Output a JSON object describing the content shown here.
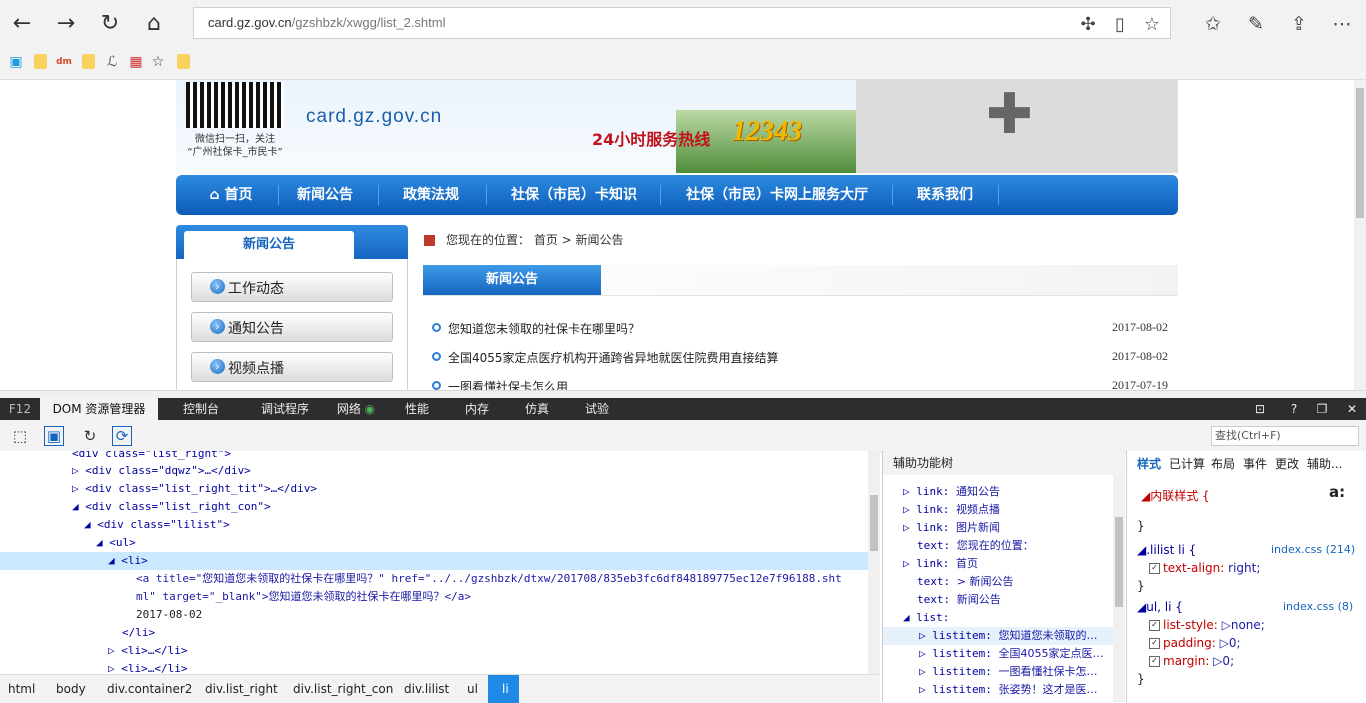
{
  "browser": {
    "url_host": "card.gz.gov.cn",
    "url_path": "/gzshbzk/xwgg/list_2.shtml"
  },
  "banner": {
    "qr_caption1": "微信扫一扫，关注",
    "qr_caption2": "“广州社保卡_市民卡”",
    "site_url": "card.gz.gov.cn",
    "hotline_label": "24小时服务热线",
    "hotline_number": "12343"
  },
  "nav": {
    "items": [
      "首页",
      "新闻公告",
      "政策法规",
      "社保（市民）卡知识",
      "社保（市民）卡网上服务大厅",
      "联系我们"
    ]
  },
  "sidebar": {
    "heading": "新闻公告",
    "items": [
      "工作动态",
      "通知公告",
      "视频点播"
    ]
  },
  "content": {
    "breadcrumb": "您现在的位置： 首页 > 新闻公告",
    "list_tab": "新闻公告",
    "news": [
      {
        "title": "您知道您未领取的社保卡在哪里吗？",
        "date": "2017-08-02"
      },
      {
        "title": "全国4055家定点医疗机构开通跨省异地就医住院费用直接结算",
        "date": "2017-08-02"
      },
      {
        "title": "一图看懂社保卡怎么用",
        "date": "2017-07-19"
      }
    ]
  },
  "devtools": {
    "tabs": [
      "F12",
      "DOM 资源管理器",
      "控制台",
      "调试程序",
      "网络",
      "性能",
      "内存",
      "仿真",
      "试验"
    ],
    "find_placeholder": "查找(Ctrl+F)",
    "dom_lines": [
      {
        "text": "<div class=\"list_right\">"
      },
      {
        "text": "▷ <div class=\"dqwz\">…</div>"
      },
      {
        "text": "▷ <div class=\"list_right_tit\">…</div>"
      },
      {
        "text": "◢ <div class=\"list_right_con\">"
      },
      {
        "text": "◢ <div class=\"lilist\">"
      },
      {
        "text": "◢ <ul>"
      },
      {
        "text": "◢ <li>"
      },
      {
        "text": "<a title=\"您知道您未领取的社保卡在哪里吗？\" href=\"../../gzshbzk/dtxw/201708/835eb3fc6df848189775ec12e7f96188.sht"
      },
      {
        "text": "ml\" target=\"_blank\">您知道您未领取的社保卡在哪里吗？</a>"
      },
      {
        "text": "2017-08-02"
      },
      {
        "text": "</li>"
      },
      {
        "text": "▷ <li>…</li>"
      },
      {
        "text": "▷ <li>…</li>"
      }
    ],
    "breadcrumbs": [
      "html",
      "body",
      "div.container2",
      "div.list_right",
      "div.list_right_con",
      "div.lilist",
      "ul",
      "li"
    ],
    "accessibility": {
      "title": "辅助功能树",
      "lines": [
        {
          "k": "▷ link:",
          "v": "通知公告"
        },
        {
          "k": "▷ link:",
          "v": "视频点播"
        },
        {
          "k": "▷ link:",
          "v": "图片新闻"
        },
        {
          "k": "text:",
          "v": "您现在的位置："
        },
        {
          "k": "▷ link:",
          "v": "首页"
        },
        {
          "k": "text:",
          "v": "> 新闻公告"
        },
        {
          "k": "text:",
          "v": "新闻公告"
        },
        {
          "k": "◢ list:",
          "v": ""
        },
        {
          "k": "▷ listitem:",
          "v": "您知道您未领取的…"
        },
        {
          "k": "▷ listitem:",
          "v": "全国4055家定点医…"
        },
        {
          "k": "▷ listitem:",
          "v": "一图看懂社保卡怎…"
        },
        {
          "k": "▷ listitem:",
          "v": "张姿势！这才是医…"
        }
      ]
    },
    "styles": {
      "tabs": [
        "样式",
        "已计算",
        "布局",
        "事件",
        "更改",
        "辅助..."
      ],
      "inline_label": "内联样式  {",
      "rule1_selector": ".lilist li  {",
      "rule1_source": "index.css (214)",
      "rule1_prop": "text-align:",
      "rule1_val": "right;",
      "rule2_selector": "ul, li  {",
      "rule2_source": "index.css (8)",
      "rule2_props": [
        {
          "p": "list-style:",
          "v": "▷none;"
        },
        {
          "p": "padding:",
          "v": "▷0;"
        },
        {
          "p": "margin:",
          "v": "▷0;"
        }
      ],
      "close_brace": "}"
    }
  }
}
